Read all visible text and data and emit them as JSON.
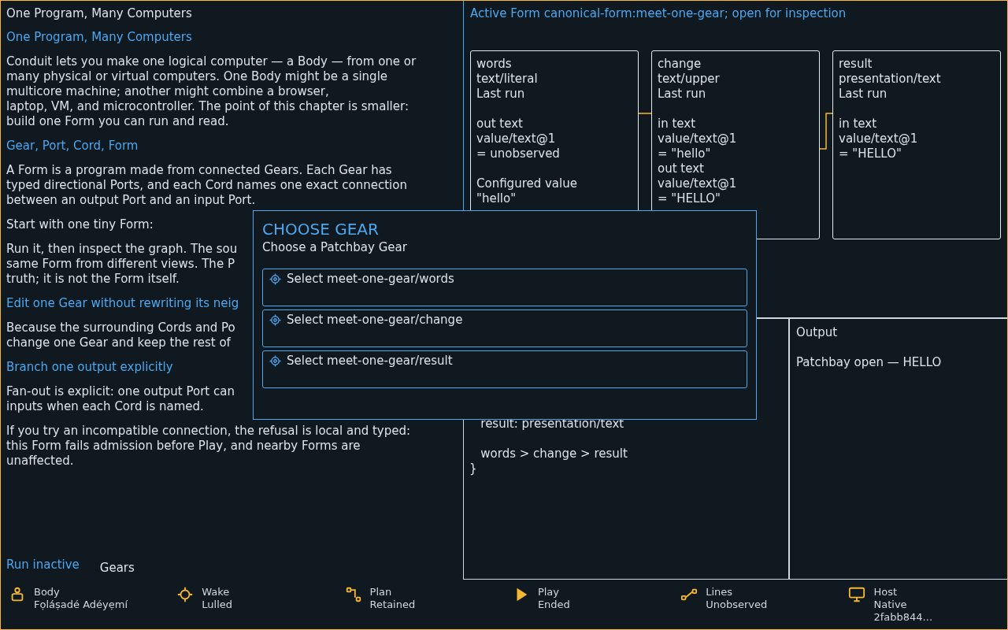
{
  "article": {
    "title": "One Program, Many Computers",
    "blocks": [
      {
        "kind": "heading",
        "lines": [
          "One Program, Many Computers"
        ]
      },
      {
        "kind": "paragraph",
        "lines": [
          "Conduit lets you make one logical computer — a Body — from one or",
          "many physical or virtual computers. One Body might be a single",
          "multicore machine; another might combine a browser,",
          "laptop, VM, and microcontroller. The point of this chapter is smaller:",
          "build one Form you can run and read."
        ]
      },
      {
        "kind": "heading",
        "lines": [
          "Gear, Port, Cord, Form"
        ]
      },
      {
        "kind": "paragraph",
        "lines": [
          "A Form is a program made from connected Gears. Each Gear has",
          "typed directional Ports, and each Cord names one exact connection",
          "between an output Port and an input Port."
        ]
      },
      {
        "kind": "paragraph",
        "lines": [
          "Start with one tiny Form:"
        ]
      },
      {
        "kind": "paragraph",
        "lines": [
          "Run it, then inspect the graph. The sou",
          "same Form from different views. The P",
          "truth; it is not the Form itself."
        ]
      },
      {
        "kind": "heading",
        "lines": [
          "Edit one Gear without rewriting its neig"
        ]
      },
      {
        "kind": "paragraph",
        "lines": [
          "Because the surrounding Cords and Po",
          "change one Gear and keep the rest of"
        ]
      },
      {
        "kind": "heading",
        "lines": [
          "Branch one output explicitly"
        ]
      },
      {
        "kind": "paragraph",
        "lines": [
          "Fan-out is explicit: one output Port can",
          "inputs when each Cord is named."
        ]
      },
      {
        "kind": "paragraph",
        "lines": [
          "If you try an incompatible connection, the refusal is local and typed:",
          "this Form fails admission before Play, and nearby Forms are",
          "unaffected."
        ]
      }
    ]
  },
  "footer": {
    "run_link": "Run inactive",
    "gears_label": "Gears"
  },
  "form_panel": {
    "title": "Active Form canonical-form:meet-one-gear; open for inspection",
    "gears": [
      {
        "sections": [
          [
            "words",
            "text/literal",
            "Last run"
          ],
          [
            "out text",
            "value/text@1",
            "= unobserved"
          ],
          [
            "Configured value",
            "\"hello\""
          ]
        ]
      },
      {
        "sections": [
          [
            "change",
            "text/upper",
            "Last run"
          ],
          [
            "in text",
            "value/text@1",
            "= \"hello\"",
            "out text",
            "value/text@1",
            "= \"HELLO\""
          ]
        ]
      },
      {
        "sections": [
          [
            "result",
            "presentation/text",
            "Last run"
          ],
          [
            "in text",
            "value/text@1",
            "= \"HELLO\""
          ]
        ]
      }
    ]
  },
  "source_panel": {
    "code": "   result: presentation/text\n\n   words > change > result\n}"
  },
  "output_panel": {
    "title": "Output",
    "text": "Patchbay open — HELLO"
  },
  "dialog": {
    "title": "CHOOSE GEAR",
    "subtitle": "Choose a Patchbay Gear",
    "options": [
      "Select meet-one-gear/words",
      "Select meet-one-gear/change",
      "Select meet-one-gear/result"
    ]
  },
  "status_bar": [
    {
      "label": "Body",
      "value": "Fọláṣadé Adéyẹmí"
    },
    {
      "label": "Wake",
      "value": "Lulled"
    },
    {
      "label": "Plan",
      "value": "Retained"
    },
    {
      "label": "Play",
      "value": "Ended"
    },
    {
      "label": "Lines",
      "value": "Unobserved"
    },
    {
      "label": "Host",
      "value": "Native\n2fabb844..."
    }
  ]
}
